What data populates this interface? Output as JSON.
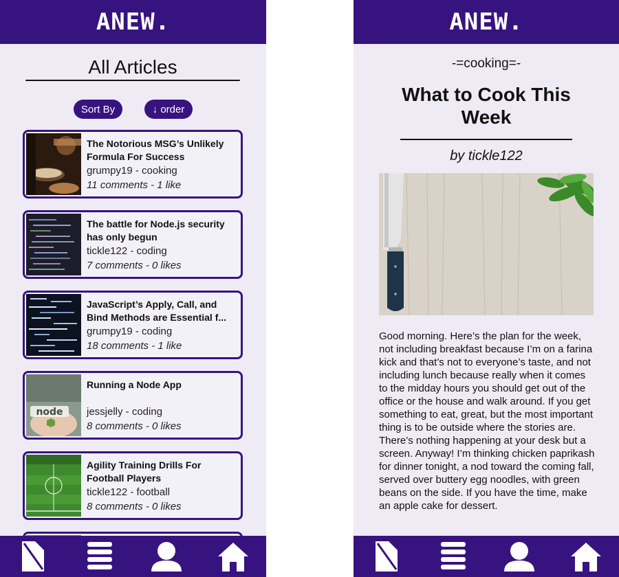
{
  "app": {
    "logo": "ANEW."
  },
  "list_screen": {
    "title": "All Articles",
    "sort_label": "Sort By",
    "order_label": "↓ order",
    "articles": [
      {
        "title": "The Notorious MSG’s Unlikely Formula For Success",
        "meta": "grumpy19 - cooking",
        "stats": "11 comments - 1 like",
        "thumb": "cooking-photo"
      },
      {
        "title": "The battle for Node.js security has only begun",
        "meta": "tickle122 - coding",
        "stats": "7 comments - 0 likes",
        "thumb": "code-screen-photo"
      },
      {
        "title": "JavaScript’s Apply, Call, and Bind Methods are Essential f...",
        "meta": "grumpy19 - coding",
        "stats": "18 comments - 1 like",
        "thumb": "code-matrix-photo"
      },
      {
        "title": "Running a Node App",
        "meta": "jessjelly - coding",
        "stats": "8 comments - 0 likes",
        "thumb": "node-logo-photo"
      },
      {
        "title": "Agility Training Drills For Football Players",
        "meta": "tickle122 - football",
        "stats": "8 comments - 0 likes",
        "thumb": "football-pitch-photo"
      }
    ]
  },
  "article_screen": {
    "category": "-=cooking=-",
    "title": "What to Cook This Week",
    "byline": "by tickle122",
    "hero": "knife-on-wooden-board-photo",
    "body": "Good morning. Here’s the plan for the week, not including breakfast because I’m on a farina kick and that’s not to everyone’s taste, and not including lunch because really when it comes to the midday hours you should get out of the office or the house and walk around. If you get something to eat, great, but the most important thing is to be outside where the stories are. There’s nothing happening at your desk but a screen. Anyway! I’m thinking chicken paprikash for dinner tonight, a nod toward the coming fall, served over buttery egg noodles, with green beans on the side. If you have the time, make an apple cake for dessert."
  },
  "nav": {
    "icons": [
      "post-article-icon",
      "articles-list-icon",
      "profile-icon",
      "home-icon"
    ]
  },
  "colors": {
    "brand": "#37137f",
    "background": "#eeebf5"
  }
}
